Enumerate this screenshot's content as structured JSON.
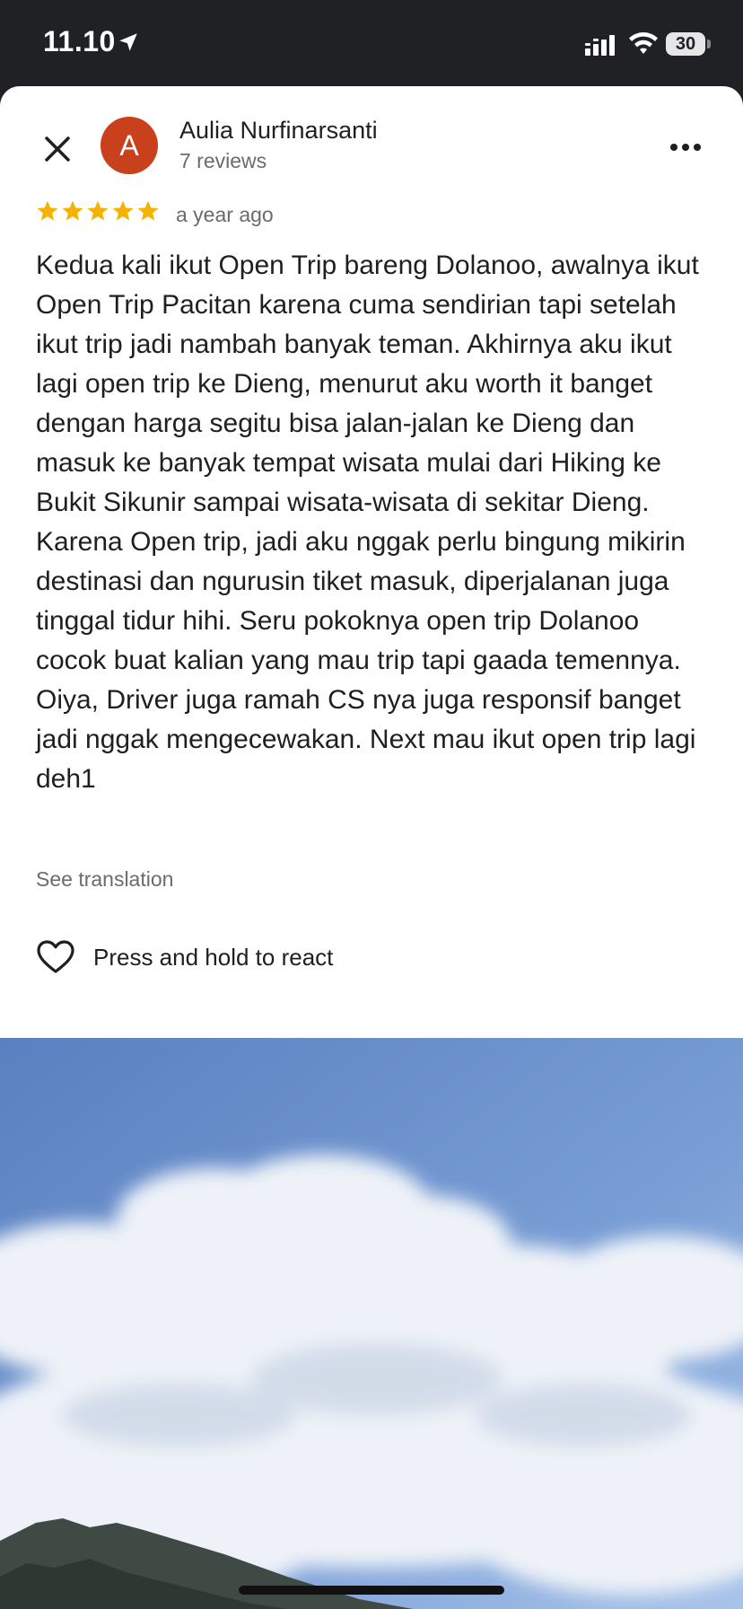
{
  "status_bar": {
    "time": "11.10",
    "battery": "30"
  },
  "review": {
    "author_initial": "A",
    "author_name": "Aulia Nurfinarsanti",
    "author_reviews": "7 reviews",
    "rating": 5,
    "date": "a year ago",
    "text": "Kedua kali ikut Open Trip bareng Dolanoo, awalnya ikut Open Trip Pacitan karena cuma sendirian tapi setelah ikut trip jadi nambah banyak teman. Akhirnya aku ikut lagi open trip ke Dieng, menurut aku worth it banget dengan harga segitu bisa jalan-jalan ke Dieng dan masuk ke banyak tempat wisata mulai dari Hiking ke Bukit Sikunir sampai wisata-wisata di sekitar Dieng. Karena Open trip, jadi aku nggak perlu bingung mikirin destinasi dan ngurusin tiket masuk, diperjalanan juga tinggal tidur hihi. Seru pokoknya open trip Dolanoo cocok buat kalian yang mau trip tapi gaada temennya. Oiya, Driver juga ramah CS nya juga responsif banget jadi nggak mengecewakan. Next mau ikut open trip lagi deh1",
    "see_translation": "See translation",
    "react_label": "Press and hold to react"
  },
  "colors": {
    "avatar": "#c9401c",
    "star": "#f5b301",
    "sky_top": "#5f86c4",
    "sky_bottom": "#9fbde6"
  },
  "icons": {
    "close": "close-icon",
    "more": "more-icon",
    "star": "star-icon",
    "heart": "heart-outline-icon",
    "location": "location-arrow-icon",
    "signal": "signal-icon",
    "wifi": "wifi-icon"
  },
  "photo": {
    "subject": "sky-with-clouds"
  }
}
